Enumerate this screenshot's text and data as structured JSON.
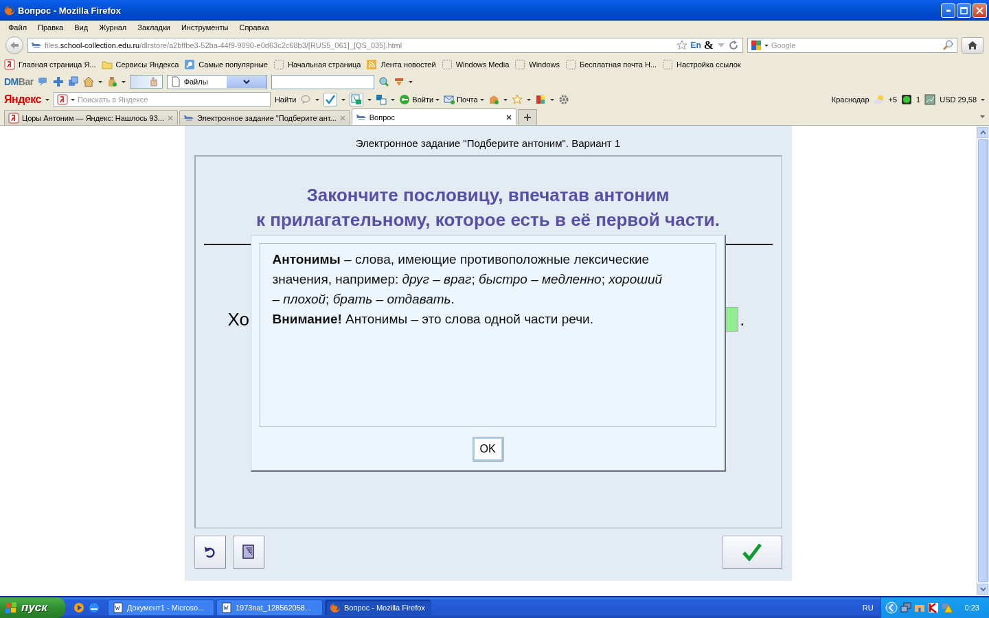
{
  "window": {
    "title": "Вопрос - Mozilla Firefox"
  },
  "menu": [
    "Файл",
    "Правка",
    "Вид",
    "Журнал",
    "Закладки",
    "Инструменты",
    "Справка"
  ],
  "address_bar": {
    "url_prefix": "files.",
    "url_domain": "school-collection.edu.ru",
    "url_path": "/dlrstore/a2bffbe3-52ba-44f9-9090-e0d63c2c68b3/[RUS5_061]_[QS_035].html",
    "lang_badge": "En",
    "amp_glyph": "&"
  },
  "search_bar": {
    "placeholder": "Google"
  },
  "bookmarks": [
    {
      "label": "Главная страница Я...",
      "kind": "yandex"
    },
    {
      "label": "Сервисы Яндекса",
      "kind": "folder"
    },
    {
      "label": "Самые популярные",
      "kind": "search"
    },
    {
      "label": "Начальная страница",
      "kind": "page"
    },
    {
      "label": "Лента новостей",
      "kind": "rss"
    },
    {
      "label": "Windows Media",
      "kind": "page"
    },
    {
      "label": "Windows",
      "kind": "page"
    },
    {
      "label": "Бесплатная почта Н...",
      "kind": "page"
    },
    {
      "label": "Настройка ссылок",
      "kind": "page"
    }
  ],
  "dmbar": {
    "logo_dm": "DM",
    "logo_bar": "Bar",
    "dropdown": "Файлы"
  },
  "yandex_bar": {
    "logo": "Яндекс",
    "search_placeholder": "Поискать в Яндексе",
    "find_button": "Найти",
    "login": "Войти",
    "mail": "Почта",
    "city": "Краснодар",
    "temperature": "+5",
    "traffic": "1",
    "currency": "USD 29,58"
  },
  "tabs": [
    {
      "label": "Цоры Антоним — Яндекс: Нашлось 93...",
      "kind": "yandex",
      "selected": false
    },
    {
      "label": "Электронное задание \"Подберите ант...",
      "kind": "page",
      "selected": false
    },
    {
      "label": "Вопрос",
      "kind": "page",
      "selected": true
    }
  ],
  "page": {
    "header": "Электронное задание \"Подберите антоним\". Вариант 1",
    "heading": [
      "Закончите пословицу, впечатав антоним",
      "к прилагательному, которое есть в её первой части."
    ],
    "proverb_start": "Хо",
    "proverb_end": ".",
    "dialog": {
      "paragraphs": [
        "**Антонимы** – слова, имеющие противоположные лексические значения, например: *друг – враг*; *быстро – медленно*; *хороший – плохой*; *брать – отдавать*.",
        "**Внимание!** Антонимы – это слова одной части речи."
      ],
      "ok": "OK"
    }
  },
  "taskbar": {
    "start": "пуск",
    "tasks": [
      {
        "label": "Документ1 - Microso...",
        "kind": "word",
        "selected": false
      },
      {
        "label": "1973nat_128562058...",
        "kind": "word",
        "selected": false
      },
      {
        "label": "Вопрос - Mozilla Firefox",
        "kind": "firefox",
        "selected": true
      }
    ],
    "language": "RU",
    "clock": "0:23"
  }
}
